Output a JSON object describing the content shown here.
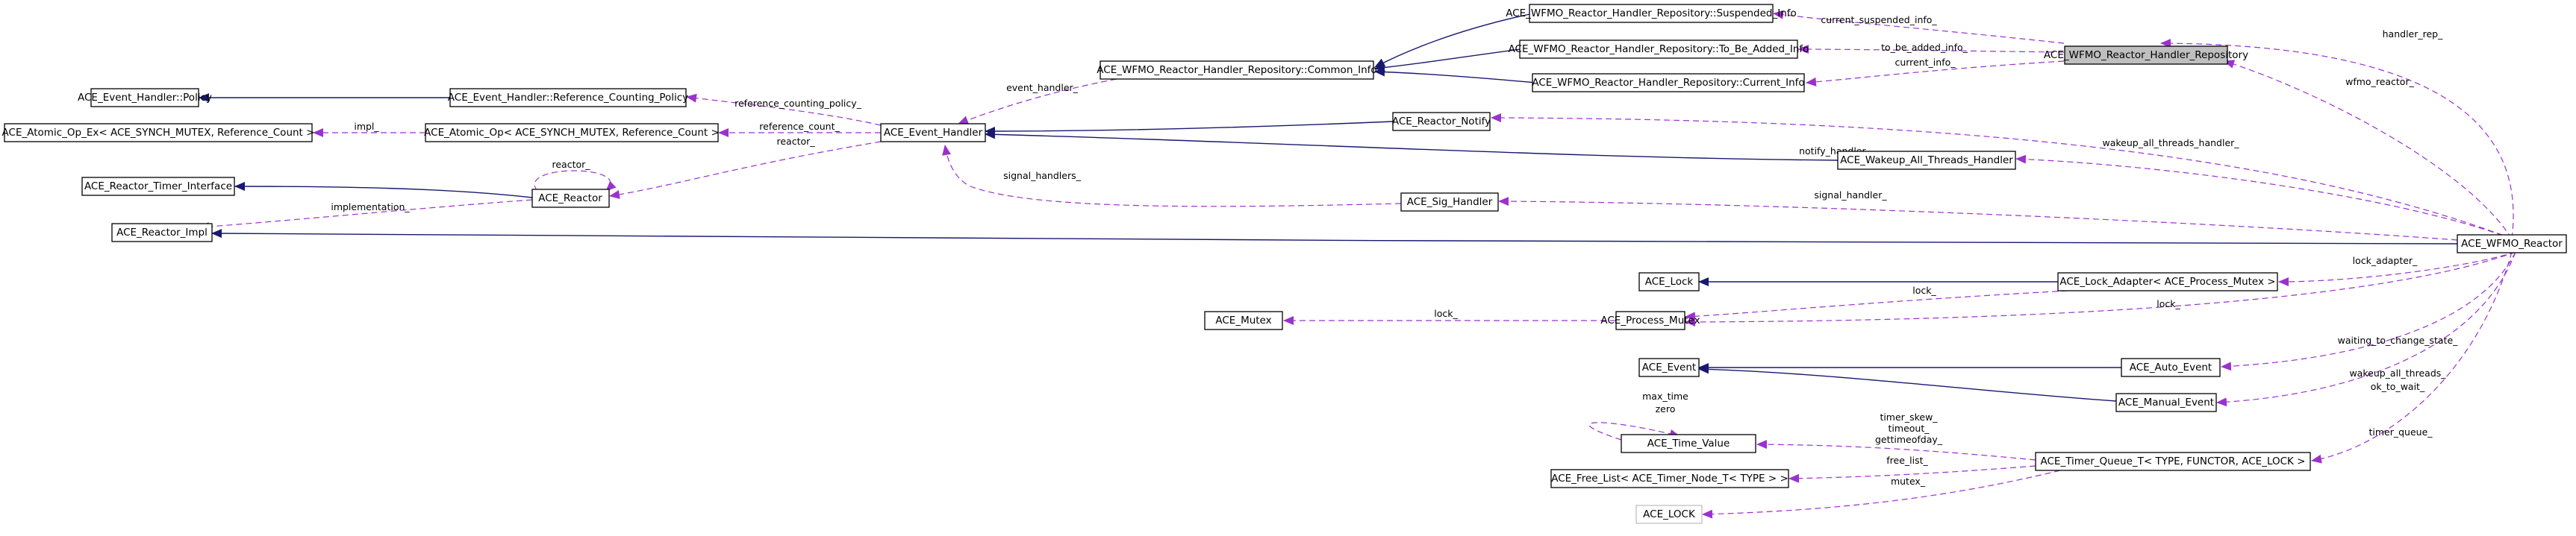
{
  "nodes": {
    "suspended_info": "ACE_WFMO_Reactor_Handler_Repository::Suspended_Info",
    "to_be_added_info": "ACE_WFMO_Reactor_Handler_Repository::To_Be_Added_Info",
    "current_info": "ACE_WFMO_Reactor_Handler_Repository::Current_Info",
    "common_info": "ACE_WFMO_Reactor_Handler_Repository::Common_Info",
    "handler_repository": "ACE_WFMO_Reactor_Handler_Repository",
    "event_handler_policy": "ACE_Event_Handler::Policy",
    "ref_counting_policy": "ACE_Event_Handler::Reference_Counting_Policy",
    "atomic_op_ex": "ACE_Atomic_Op_Ex< ACE_SYNCH_MUTEX, Reference_Count >",
    "atomic_op": "ACE_Atomic_Op< ACE_SYNCH_MUTEX, Reference_Count >",
    "event_handler": "ACE_Event_Handler",
    "reactor_notify": "ACE_Reactor_Notify",
    "wakeup_all_threads_handler": "ACE_Wakeup_All_Threads_Handler",
    "reactor_timer_interface": "ACE_Reactor_Timer_Interface",
    "reactor": "ACE_Reactor",
    "sig_handler": "ACE_Sig_Handler",
    "reactor_impl": "ACE_Reactor_Impl",
    "wfmo_reactor": "ACE_WFMO_Reactor",
    "lock": "ACE_Lock",
    "lock_adapter": "ACE_Lock_Adapter< ACE_Process_Mutex >",
    "mutex": "ACE_Mutex",
    "process_mutex": "ACE_Process_Mutex",
    "event": "ACE_Event",
    "auto_event": "ACE_Auto_Event",
    "manual_event": "ACE_Manual_Event",
    "time_value": "ACE_Time_Value",
    "timer_queue": "ACE_Timer_Queue_T< TYPE, FUNCTOR, ACE_LOCK >",
    "free_list": "ACE_Free_List< ACE_Timer_Node_T< TYPE > >",
    "ace_lock_tpl": "ACE_LOCK"
  },
  "edge_labels": {
    "current_suspended_info": "current_suspended_info_",
    "to_be_added_info": "to_be_added_info_",
    "current_info": "current_info_",
    "handler_rep": "handler_rep_",
    "event_handler": "event_handler_",
    "wfmo_reactor": "wfmo_reactor_",
    "reference_counting_policy": "reference_counting_policy_",
    "impl": "impl_",
    "reference_count": "reference_count_",
    "reactor": "reactor_",
    "reactor_self": "reactor_",
    "notify_handler": "notify_handler_",
    "wakeup_all_threads_handler": "wakeup_all_threads_handler_",
    "implementation": "implementation_",
    "signal_handlers": "signal_handlers_",
    "signal_handler": "signal_handler_",
    "lock_adapter": "lock_adapter_",
    "lock_1": "lock_",
    "lock_2": "lock_",
    "lock_3": "lock_",
    "waiting_to_change_state": "waiting_to_change_state_",
    "wakeup_all_threads_1": "wakeup_all_threads_",
    "wakeup_all_threads_2": "ok_to_wait_",
    "max_time": "max_time",
    "zero": "zero",
    "timer_skew": "timer_skew_",
    "timeout": "timeout_",
    "gettimeofday": "gettimeofday_",
    "free_list": "free_list_",
    "mutex": "mutex_",
    "timer_queue": "timer_queue_"
  }
}
